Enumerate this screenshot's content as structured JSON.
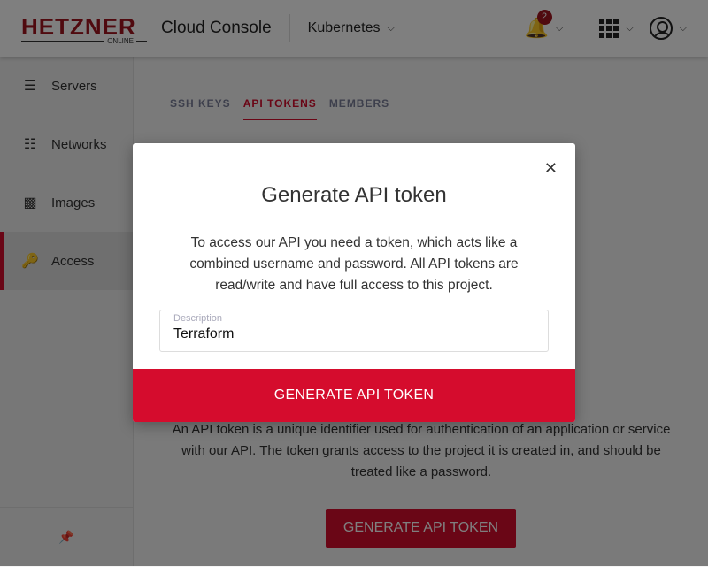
{
  "header": {
    "logo": "HETZNER",
    "logo_sub": "ONLINE",
    "title": "Cloud Console",
    "project": "Kubernetes",
    "notifications": "2"
  },
  "sidebar": {
    "items": [
      {
        "label": "Servers",
        "icon": "server-icon"
      },
      {
        "label": "Networks",
        "icon": "network-icon"
      },
      {
        "label": "Images",
        "icon": "images-icon"
      },
      {
        "label": "Access",
        "icon": "key-icon",
        "active": true
      }
    ],
    "pin_icon": "pin-icon"
  },
  "tabs": [
    {
      "label": "SSH KEYS"
    },
    {
      "label": "API TOKENS",
      "active": true
    },
    {
      "label": "MEMBERS"
    }
  ],
  "main": {
    "info": "An API token is a unique identifier used for authentication of an application or service with our API. The token grants access to the project it is created in, and should be treated like a password.",
    "button": "GENERATE API TOKEN"
  },
  "modal": {
    "title": "Generate API token",
    "text": "To access our API you need a token, which acts like a combined username and password. All API tokens are read/write and have full access to this project.",
    "field_label": "Description",
    "field_value": "Terraform",
    "submit": "GENERATE API TOKEN"
  },
  "colors": {
    "accent": "#d50c2d",
    "brand": "#a0141e"
  }
}
